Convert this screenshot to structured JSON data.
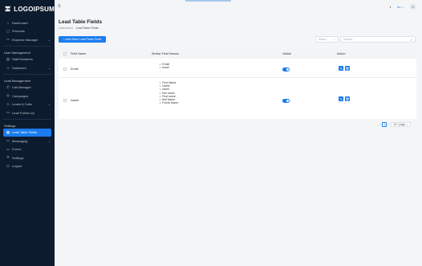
{
  "app": {
    "logo_text": "LOGOIPSUM"
  },
  "sidebar": {
    "items_top": [
      {
        "label": "Dashboard",
        "icon": "home-icon"
      },
      {
        "label": "Products",
        "icon": "box-icon"
      },
      {
        "label": "Expense Manager",
        "icon": "wallet-icon",
        "chevron": true
      }
    ],
    "sections": [
      {
        "title": "User Management",
        "items": [
          {
            "label": "Staff Members",
            "icon": "id-card-icon"
          },
          {
            "label": "Salesmen",
            "icon": "users-icon",
            "chevron": true
          }
        ]
      },
      {
        "title": "Lead Management",
        "items": [
          {
            "label": "Call Manager",
            "icon": "phone-icon"
          },
          {
            "label": "Campaigns",
            "icon": "target-icon"
          },
          {
            "label": "Leads & Calls",
            "icon": "user-icon",
            "chevron": true
          },
          {
            "label": "Lead Follow Up",
            "icon": "follow-up-icon"
          }
        ]
      },
      {
        "title": "Settings",
        "items": [
          {
            "label": "Lead Table Fields",
            "icon": "table-icon",
            "active": true
          },
          {
            "label": "Messaging",
            "icon": "message-icon",
            "chevron": true
          },
          {
            "label": "Forms",
            "icon": "form-icon"
          },
          {
            "label": "Settings",
            "icon": "gear-icon"
          },
          {
            "label": "Logout",
            "icon": "logout-icon"
          }
        ]
      }
    ]
  },
  "topbar": {
    "lang": "en",
    "avatar": "user-avatar"
  },
  "page": {
    "title": "Lead Table Fields",
    "breadcrumb_root": "Dashboard",
    "breadcrumb_current": "Lead Table Fields",
    "add_button": "+ Add New Lead Table Field",
    "select_placeholder": "Status",
    "search_placeholder": "Search..."
  },
  "table": {
    "headers": [
      "Field Name",
      "Similar Field Names",
      "Visible",
      "Action"
    ],
    "rows": [
      {
        "field": "Email",
        "similar": [
          "Email",
          "email"
        ],
        "visible": true
      },
      {
        "field": "Name",
        "similar": [
          "First Name",
          "Name",
          "name",
          "first name",
          "First name",
          "first Name",
          "Fornis Name"
        ],
        "visible": true
      }
    ]
  },
  "pagination": {
    "current_page": "1",
    "per_page": "10 / page",
    "prev": "‹",
    "next": "›"
  },
  "colors": {
    "sidebar_bg": "#0d1b2e",
    "accent": "#1a7cf0",
    "page_bg": "#f4f5f7"
  }
}
